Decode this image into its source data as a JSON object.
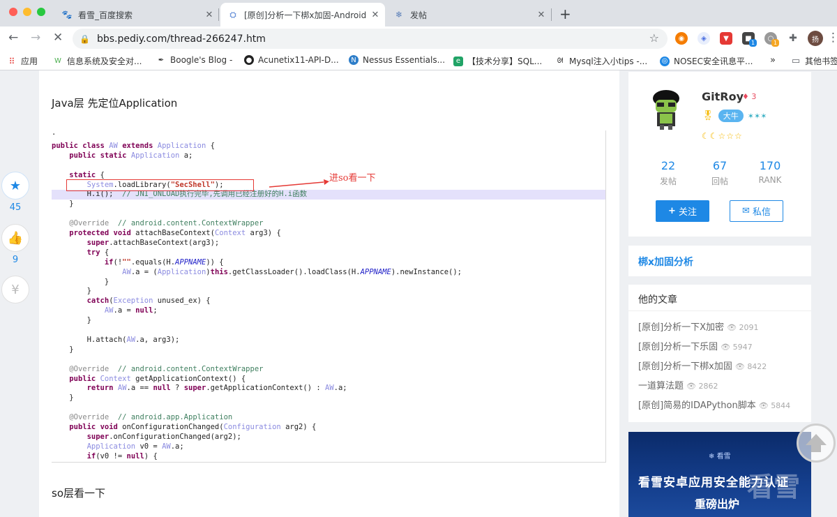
{
  "browser": {
    "tabs": [
      {
        "title": "看雪_百度搜索",
        "icon": "baidu-paw-icon"
      },
      {
        "title": "[原创]分析一下梆x加固-Android",
        "icon": "kanxue-icon"
      },
      {
        "title": "发帖",
        "icon": "snowflake-icon"
      }
    ],
    "url": "bbs.pediy.com/thread-266247.htm",
    "bookmarks": [
      "应用",
      "信息系统及安全对...",
      "Boogle's Blog -",
      "Acunetix11-API-D...",
      "Nessus Essentials...",
      "【技术分享】SQL...",
      "Mysql注入小tips -...",
      "NOSEC安全讯息平...",
      "»",
      "其他书签"
    ],
    "ext_badges": {
      "a": "1",
      "b": "1"
    },
    "profile_initial": "扬"
  },
  "sidebar": {
    "collect_count": "45",
    "like_count": "9",
    "reward_symbol": "¥"
  },
  "article": {
    "heading1": "Java层 先定位Application",
    "heading2": "so层看一下",
    "annotation": "进so看一下",
    "code_lines": [
      ".",
      "public class AW extends Application {",
      "    public static Application a;",
      "",
      "    static {",
      "        System.loadLibrary(\"SecShell\");",
      "        H.i();  // JNI_ONLOAD执行完毕,先调用已经注册好的H.i函数",
      "    }",
      "",
      "    @Override  // android.content.ContextWrapper",
      "    protected void attachBaseContext(Context arg3) {",
      "        super.attachBaseContext(arg3);",
      "        try {",
      "            if(!\"\".equals(H.APPNAME)) {",
      "                AW.a = (Application)this.getClassLoader().loadClass(H.APPNAME).newInstance();",
      "            }",
      "        }",
      "        catch(Exception unused_ex) {",
      "            AW.a = null;",
      "        }",
      "",
      "        H.attach(AW.a, arg3);",
      "    }",
      "",
      "    @Override  // android.content.ContextWrapper",
      "    public Context getApplicationContext() {",
      "        return AW.a == null ? super.getApplicationContext() : AW.a;",
      "    }",
      "",
      "    @Override  // android.app.Application",
      "    public void onConfigurationChanged(Configuration arg2) {",
      "        super.onConfigurationChanged(arg2);",
      "        Application v0 = AW.a;",
      "        if(v0 != null) {"
    ]
  },
  "profile": {
    "name": "GitRoy",
    "level": "3",
    "badge_label": "大牛",
    "stats": [
      {
        "value": "22",
        "label": "发帖"
      },
      {
        "value": "67",
        "label": "回帖"
      },
      {
        "value": "170",
        "label": "RANK"
      }
    ],
    "follow_label": "关注",
    "message_label": "私信"
  },
  "topic_link": "梆x加固分析",
  "his_articles": {
    "title": "他的文章",
    "items": [
      {
        "title": "[原创]分析一下X加密",
        "views": "2091"
      },
      {
        "title": "[原创]分析一下乐固",
        "views": "5947"
      },
      {
        "title": "[原创]分析一下梆x加固",
        "views": "8422"
      },
      {
        "title": "一道算法题",
        "views": "2862"
      },
      {
        "title": "[原创]简易的IDAPython脚本",
        "views": "5844"
      }
    ]
  },
  "banner": {
    "logo": "看雪",
    "line1": "看雪安卓应用安全能力认证",
    "line2": "重磅出炉",
    "watermark": "看雪"
  },
  "colors": {
    "accent": "#1e88e5",
    "highlight": "#e4e1fb",
    "annotation_red": "#e53935"
  }
}
